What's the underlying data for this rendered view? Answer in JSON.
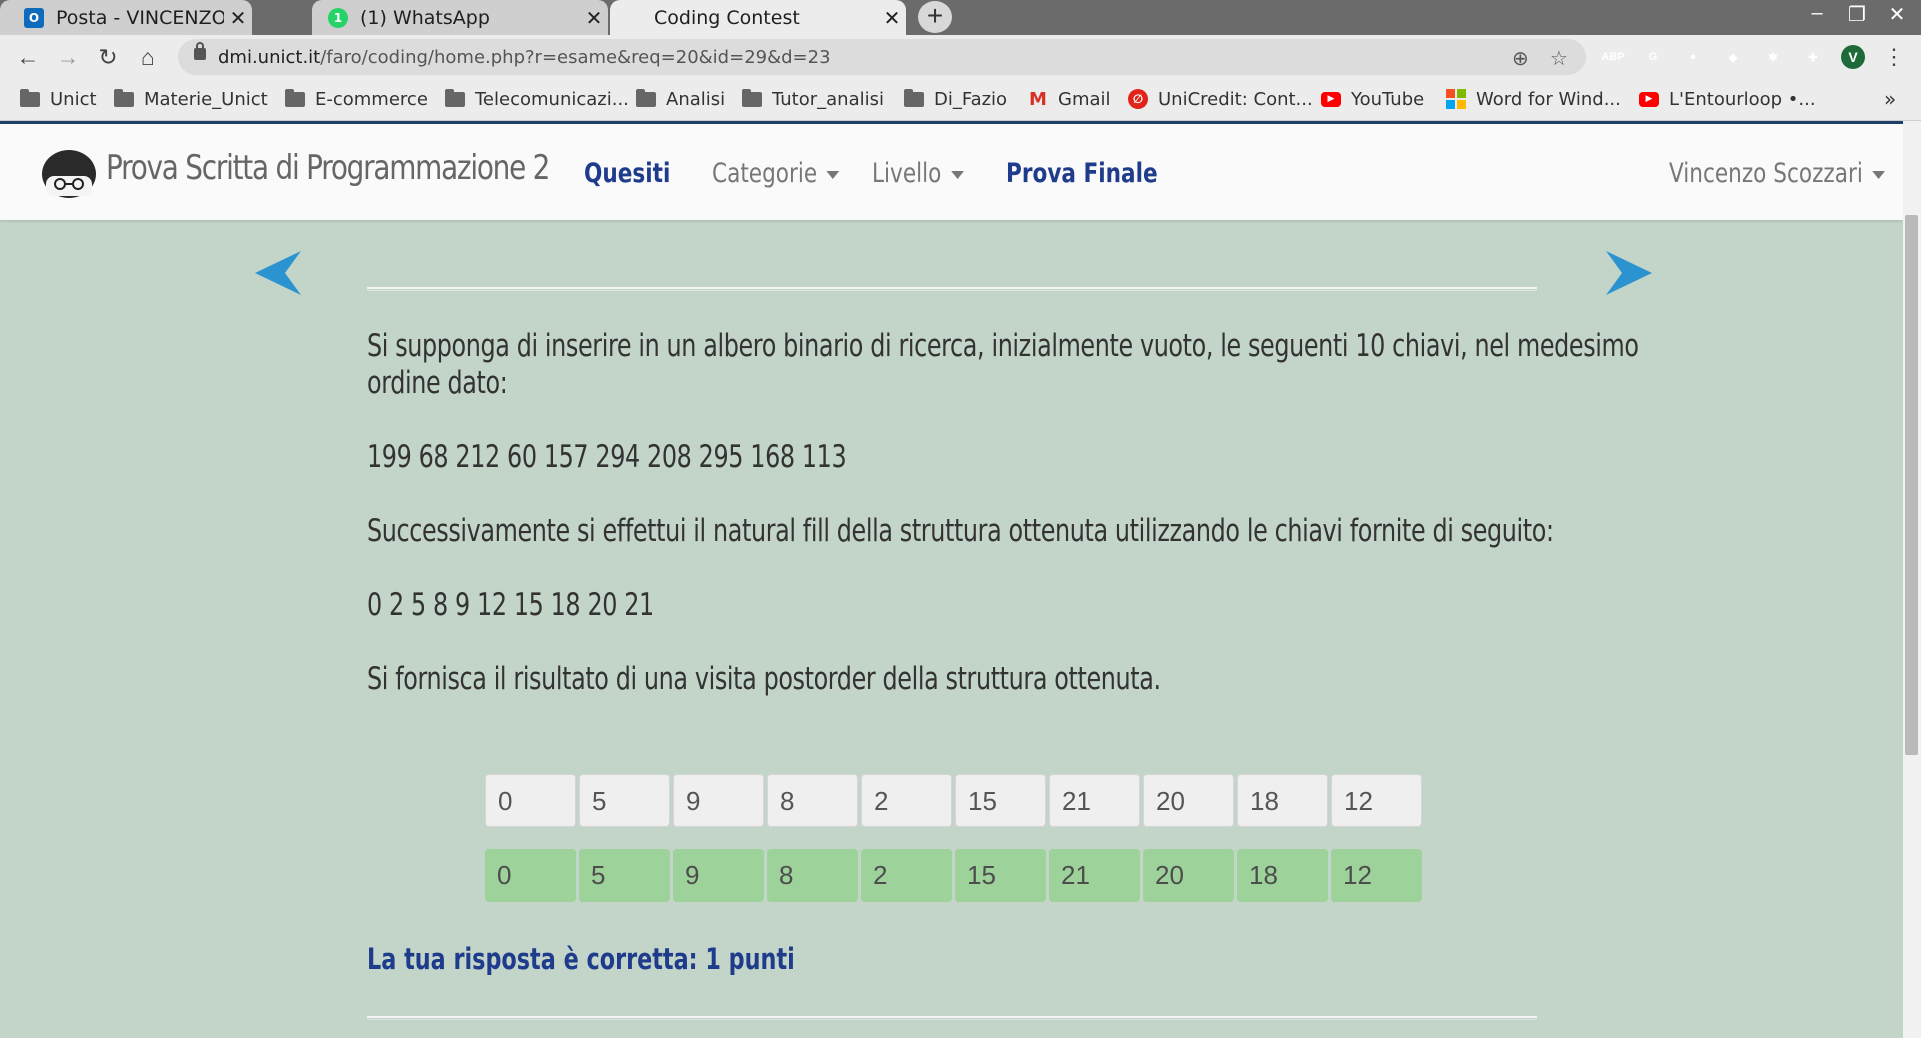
{
  "browser": {
    "tabs": [
      {
        "title": "Posta - VINCENZO SCOZZ",
        "favicon": "outlook-icon",
        "close": "✕"
      },
      {
        "title": "(1) WhatsApp",
        "favicon": "whatsapp-icon",
        "close": "✕",
        "badge": "1"
      },
      {
        "title": "Coding Contest",
        "close": "✕"
      }
    ],
    "new_tab": "+",
    "window_controls": {
      "minimize": "–",
      "restore": "❐",
      "close": "✕"
    },
    "url": {
      "host": "dmi.unict.it",
      "path": "/faro/coding/home.php?r=esame&req=20&id=29&d=23"
    },
    "extensions": [
      {
        "name": "adblock-icon",
        "label": "ABP",
        "color": "#e53935"
      },
      {
        "name": "translate-icon",
        "label": "G",
        "color": "#4a6fd8"
      },
      {
        "name": "extension-dark-icon",
        "label": "●",
        "color": "#333333"
      },
      {
        "name": "extension-color-icon",
        "label": "◆",
        "color": "#f4b400"
      },
      {
        "name": "extension-script-icon",
        "label": "✱",
        "color": "#222222"
      },
      {
        "name": "puzzle-icon",
        "label": "✚",
        "color": "#555555"
      }
    ],
    "profile_initial": "V",
    "menu_icon": "⋮",
    "bookmarks": [
      {
        "label": "Unict",
        "type": "folder"
      },
      {
        "label": "Materie_Unict",
        "type": "folder"
      },
      {
        "label": "E-commerce",
        "type": "folder"
      },
      {
        "label": "Telecomunicazi...",
        "type": "folder"
      },
      {
        "label": "Analisi",
        "type": "folder"
      },
      {
        "label": "Tutor_analisi",
        "type": "folder"
      },
      {
        "label": "Di_Fazio",
        "type": "folder"
      },
      {
        "label": "Gmail",
        "type": "gmail",
        "glyph": "M",
        "color": "#d93025"
      },
      {
        "label": "UniCredit: Cont...",
        "type": "unicredit",
        "glyph": "∅",
        "color": "#e2231a"
      },
      {
        "label": "YouTube",
        "type": "youtube",
        "glyph": "▶",
        "color": "#ff0000"
      },
      {
        "label": "Word for Wind...",
        "type": "windows",
        "glyph": "",
        "color": "#2b7cd3"
      },
      {
        "label": "L'Entourloop •...",
        "type": "youtube",
        "glyph": "▶",
        "color": "#ff0000"
      }
    ],
    "bookmarks_overflow": "»"
  },
  "site": {
    "brand": "Prova Scritta di Programmazione 2",
    "nav": {
      "quesiti": "Quesiti",
      "categorie": "Categorie",
      "livello": "Livello",
      "prova_finale": "Prova Finale",
      "user": "Vincenzo Scozzari"
    }
  },
  "question": {
    "intro_line1": "Si supponga di inserire in un albero binario di ricerca, inizialmente vuoto, le seguenti 10 chiavi, nel medesimo",
    "intro_line2": "ordine dato:",
    "keys": "199 68 212 60 157 294 208 295 168 113",
    "fill_text": "Successivamente si effettui il natural fill della struttura ottenuta utilizzando le chiavi fornite di seguito:",
    "fill_keys": "0 2 5 8 9 12 15 18 20 21",
    "task": "Si fornisca il risultato di una visita postorder della struttura ottenuta.",
    "answer": [
      "0",
      "5",
      "9",
      "8",
      "2",
      "15",
      "21",
      "20",
      "18",
      "12"
    ],
    "solution": [
      "0",
      "5",
      "9",
      "8",
      "2",
      "15",
      "21",
      "20",
      "18",
      "12"
    ],
    "verdict": "La tua risposta è corretta: 1 punti"
  },
  "colors": {
    "background": "#c3d5c9",
    "accent": "#1f3b8c",
    "arrow": "#2c93d1",
    "correct": "#9dd29a"
  }
}
